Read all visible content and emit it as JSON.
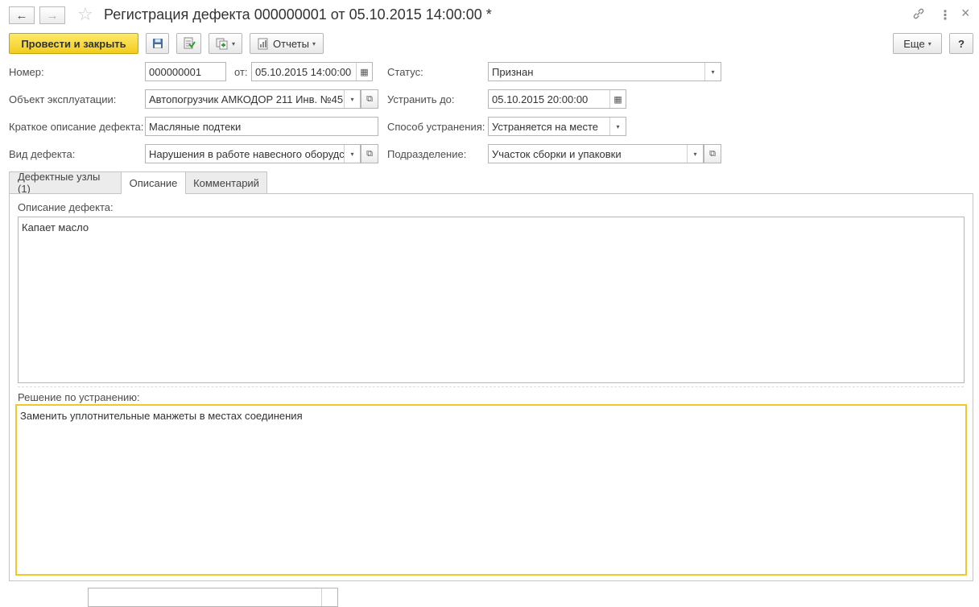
{
  "window": {
    "title": "Регистрация дефекта 000000001 от 05.10.2015 14:00:00 *"
  },
  "toolbar": {
    "post_close": "Провести и закрыть",
    "reports": "Отчеты",
    "more": "Еще",
    "help": "?"
  },
  "icons": {
    "back": "←",
    "forward": "→",
    "star": "☆",
    "link": "🔗",
    "menu": "⋮",
    "close": "×",
    "dropdown": "▾",
    "calendar": "▦",
    "open": "⧉"
  },
  "form": {
    "number_label": "Номер:",
    "number_value": "000000001",
    "date_label": "от:",
    "date_value": "05.10.2015 14:00:00",
    "status_label": "Статус:",
    "status_value": "Признан",
    "object_label": "Объект эксплуатации:",
    "object_value": "Автопогрузчик АМКОДОР 211 Инв. №45",
    "deadline_label": "Устранить до:",
    "deadline_value": "05.10.2015 20:00:00",
    "short_desc_label": "Краткое описание дефекта:",
    "short_desc_value": "Масляные подтеки",
    "method_label": "Способ устранения:",
    "method_value": "Устраняется на месте",
    "defect_type_label": "Вид дефекта:",
    "defect_type_value": "Нарушения в работе навесного оборудс",
    "department_label": "Подразделение:",
    "department_value": "Участок сборки и упаковки"
  },
  "tabs": [
    {
      "label": "Дефектные узлы (1)"
    },
    {
      "label": "Описание"
    },
    {
      "label": "Комментарий"
    }
  ],
  "description_tab": {
    "desc_label": "Описание дефекта:",
    "desc_value": "Капает масло",
    "solution_label": "Решение по устранению:",
    "solution_value": "Заменить уплотнительные манжеты в местах соединения"
  },
  "colors": {
    "primary_button": "#f2cc20",
    "focus_border": "#f0c929"
  }
}
